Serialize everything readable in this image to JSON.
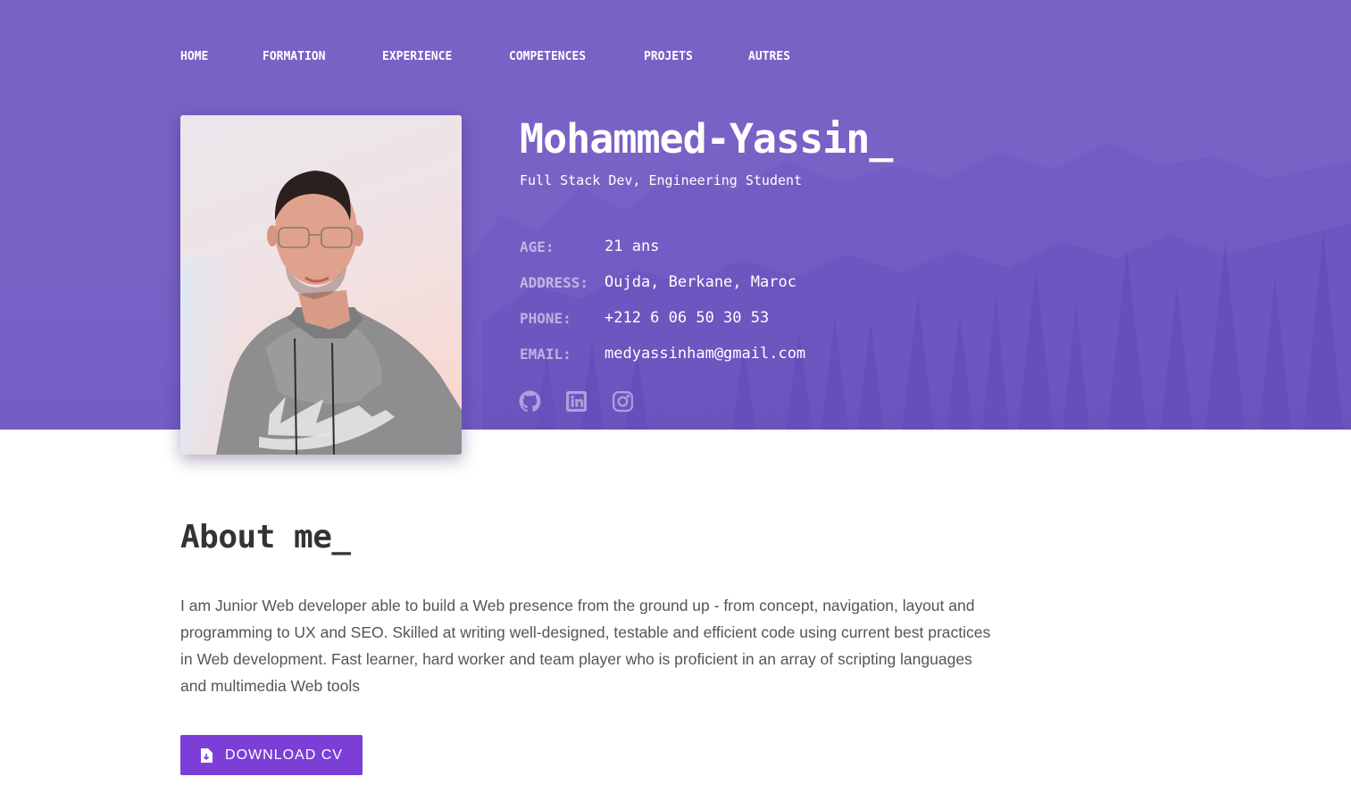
{
  "nav": {
    "items": [
      {
        "label": "HOME"
      },
      {
        "label": "FORMATION"
      },
      {
        "label": "EXPERIENCE"
      },
      {
        "label": "COMPETENCES"
      },
      {
        "label": "PROJETS"
      },
      {
        "label": "AUTRES"
      }
    ]
  },
  "profile": {
    "name": "Mohammed-Yassin_",
    "subtitle": "Full Stack Dev, Engineering Student",
    "info": [
      {
        "key": "AGE:",
        "value": "21 ans"
      },
      {
        "key": "ADDRESS:",
        "value": "Oujda, Berkane, Maroc"
      },
      {
        "key": "PHONE:",
        "value": "+212 6 06 50 30 53"
      },
      {
        "key": "EMAIL:",
        "value": "medyassinham@gmail.com"
      }
    ],
    "socials": [
      "github-icon",
      "linkedin-icon",
      "instagram-icon"
    ]
  },
  "about": {
    "title": "About me_",
    "text": "I am Junior Web developer able to build a Web presence from the ground up - from concept, navigation, layout and programming to UX and SEO. Skilled at writing well-designed, testable and efficient code using current best practices in Web development. Fast learner, hard worker and team player who is proficient in an array of scripting languages and multimedia Web tools",
    "download_label": "DOWNLOAD CV"
  },
  "colors": {
    "hero_bg": "#7862c6",
    "button_bg": "#7b3fd8",
    "heading_text": "#333333",
    "body_text": "#555555"
  }
}
